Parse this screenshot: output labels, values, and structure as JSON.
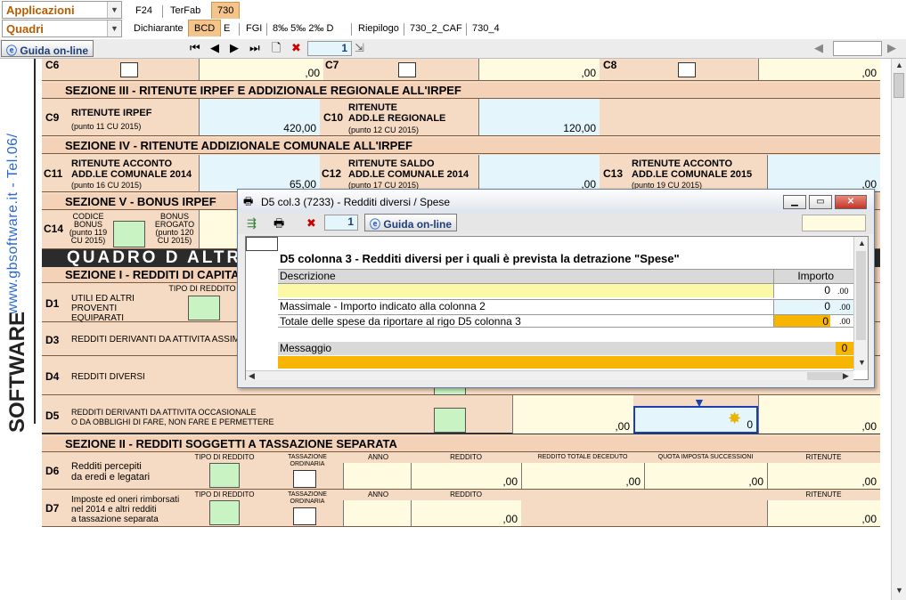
{
  "menu": {
    "applicazioni": "Applicazioni",
    "quadri": "Quadri",
    "tabs_top": [
      "F24",
      "TerFab",
      "730"
    ],
    "tabs_bottom": [
      "Dichiarante",
      "BCD",
      "E",
      "FGI",
      "8‰ 5‰ 2‰ D",
      "Riepilogo",
      "730_2_CAF",
      "730_4"
    ]
  },
  "toolbar": {
    "guida": "Guida on-line",
    "page": "1"
  },
  "brand": {
    "site": "www.gbsoftware.it - Tel.06/",
    "logo": "SOFTWARE"
  },
  "form": {
    "c6": "C6",
    "c7": "C7",
    "c8": "C8",
    "one": "1",
    "zero": ",00",
    "sec3": "SEZIONE III - RITENUTE IRPEF E ADDIZIONALE REGIONALE ALL'IRPEF",
    "c9": "C9",
    "c9_title": "RITENUTE IRPEF",
    "c9_sub": "(punto 11 CU 2015)",
    "c9_val": "420,00",
    "c10": "C10",
    "c10_title1": "RITENUTE",
    "c10_title2": "ADD.LE REGIONALE",
    "c10_sub": "(punto 12 CU 2015)",
    "c10_val": "120,00",
    "sec4": "SEZIONE IV - RITENUTE ADDIZIONALE COMUNALE ALL'IRPEF",
    "c11": "C11",
    "c11_title1": "RITENUTE ACCONTO",
    "c11_title2": "ADD.LE COMUNALE 2014",
    "c11_sub": "(punto 16 CU 2015)",
    "c11_val": "65,00",
    "c12": "C12",
    "c12_title1": "RITENUTE SALDO",
    "c12_title2": "ADD.LE COMUNALE 2014",
    "c12_sub": "(punto 17 CU 2015)",
    "c12_val": ",00",
    "c13": "C13",
    "c13_title1": "RITENUTE ACCONTO",
    "c13_title2": "ADD.LE COMUNALE 2015",
    "c13_sub": "(punto 19 CU 2015)",
    "c13_val": ",00",
    "sec5": "SEZIONE V - BONUS IRPEF",
    "c14": "C14",
    "c14_codice": "CODICE BONUS (punto 119 CU 2015)",
    "c14_bonus": "BONUS EROGATO (punto 120 CU 2015)",
    "two": "2",
    "quadro": "QUADRO D ALTRI",
    "secI": "SEZIONE I - REDDITI DI CAPITALE",
    "d1": "D1",
    "d1_text": "UTILI ED ALTRI PROVENTI EQUIPARATI",
    "tipo": "TIPO DI REDDITO",
    "d3": "D3",
    "d3_text": "REDDITI DERIVANTI DA ATTIVITA ASSIMILATE",
    "d4": "D4",
    "d4_text": "REDDITI DIVERSI",
    "d5": "D5",
    "d5_text1": "REDDITI DERIVANTI DA ATTIVITA OCCASIONALE",
    "d5_text2": "O DA OBBLIGHI DI FARE, NON FARE E PERMETTERE",
    "d5_val": ",00",
    "d5_val2": "0",
    "d5_val3": ",00",
    "secII": "SEZIONE II - REDDITI SOGGETTI A TASSAZIONE SEPARATA",
    "d6": "D6",
    "d6_text1": "Redditi percepiti",
    "d6_text2": "da eredi e legatari",
    "d7": "D7",
    "d7_text1": "Imposte ed oneri rimborsati",
    "d7_text2": "nel 2014 e altri redditi",
    "d7_text3": "a tassazione separata",
    "tass": "TASSAZIONE ORDINARIA",
    "anno": "ANNO",
    "reddito": "REDDITO",
    "deceduto": "REDDITO TOTALE DECEDUTO",
    "quota": "QUOTA IMPOSTA SUCCESSIONI",
    "ritenute": "RITENUTE",
    "n3": "3",
    "n4": "4",
    "n5": "5",
    "n6": "6",
    "n7": "7"
  },
  "dialog": {
    "title": "D5 col.3 (7233) - Redditi diversi / Spese",
    "page": "1",
    "guida": "Guida on-line",
    "heading": "D5 colonna 3 - Redditi diversi per i quali è prevista la detrazione \"Spese\"",
    "col_desc": "Descrizione",
    "col_importo": "Importo",
    "row1_val": "0",
    "row2_label": "Massimale - Importo indicato alla colonna 2",
    "row2_val": "0",
    "row3_label": "Totale delle spese da riportare al rigo D5 colonna 3",
    "row3_val": "0",
    "cents": ".00",
    "msg_label": "Messaggio",
    "msg_val": "0"
  },
  "colors": {
    "accent": "#b85c00",
    "form_bg": "#f6dbc4",
    "field_yellow": "#fffbe0",
    "field_cyan": "#e4f6fb",
    "orange": "#f7b500"
  }
}
